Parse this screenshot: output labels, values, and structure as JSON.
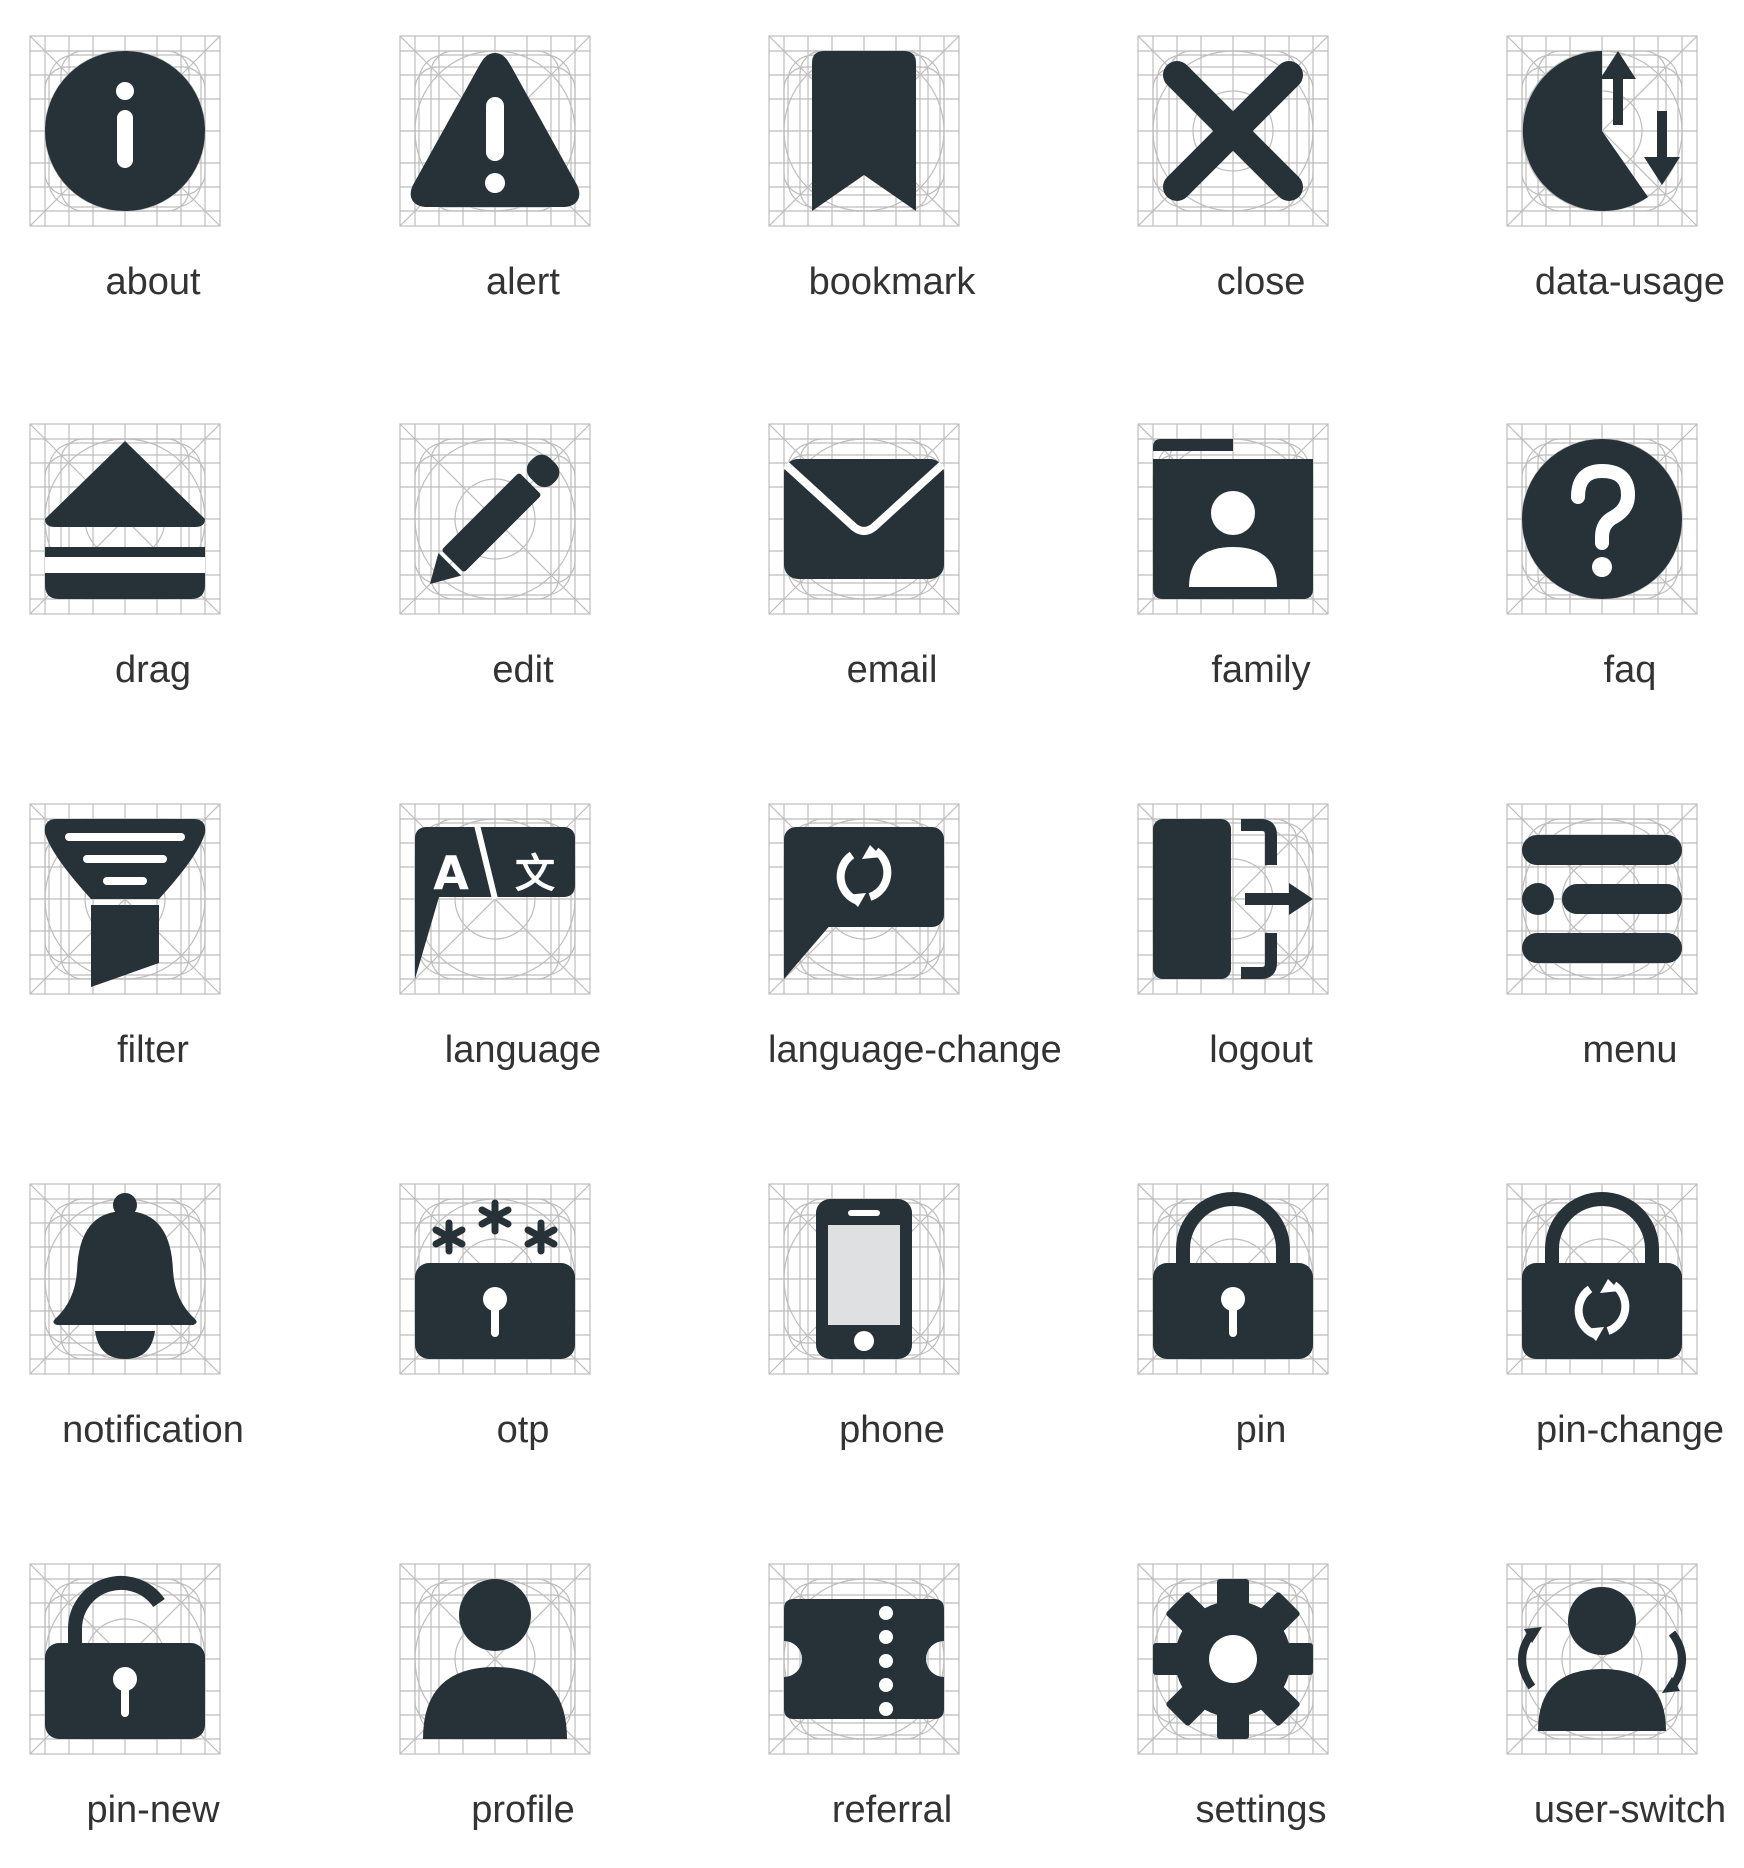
{
  "icon_color": "#263238",
  "grid_color": "#bdbdbd",
  "label_color": "#333333",
  "icons": [
    {
      "label": "about",
      "icon": "about-icon"
    },
    {
      "label": "alert",
      "icon": "alert-icon"
    },
    {
      "label": "bookmark",
      "icon": "bookmark-icon"
    },
    {
      "label": "close",
      "icon": "close-icon"
    },
    {
      "label": "data-usage",
      "icon": "data-usage-icon"
    },
    {
      "label": "drag",
      "icon": "drag-icon"
    },
    {
      "label": "edit",
      "icon": "edit-icon"
    },
    {
      "label": "email",
      "icon": "email-icon"
    },
    {
      "label": "family",
      "icon": "family-icon"
    },
    {
      "label": "faq",
      "icon": "faq-icon"
    },
    {
      "label": "filter",
      "icon": "filter-icon"
    },
    {
      "label": "language",
      "icon": "language-icon"
    },
    {
      "label": "language-change",
      "icon": "language-change-icon"
    },
    {
      "label": "logout",
      "icon": "logout-icon"
    },
    {
      "label": "menu",
      "icon": "menu-icon"
    },
    {
      "label": "notification",
      "icon": "notification-icon"
    },
    {
      "label": "otp",
      "icon": "otp-icon"
    },
    {
      "label": "phone",
      "icon": "phone-icon"
    },
    {
      "label": "pin",
      "icon": "pin-icon"
    },
    {
      "label": "pin-change",
      "icon": "pin-change-icon"
    },
    {
      "label": "pin-new",
      "icon": "pin-new-icon"
    },
    {
      "label": "profile",
      "icon": "profile-icon"
    },
    {
      "label": "referral",
      "icon": "referral-icon"
    },
    {
      "label": "settings",
      "icon": "settings-icon"
    },
    {
      "label": "user-switch",
      "icon": "user-switch-icon"
    }
  ]
}
